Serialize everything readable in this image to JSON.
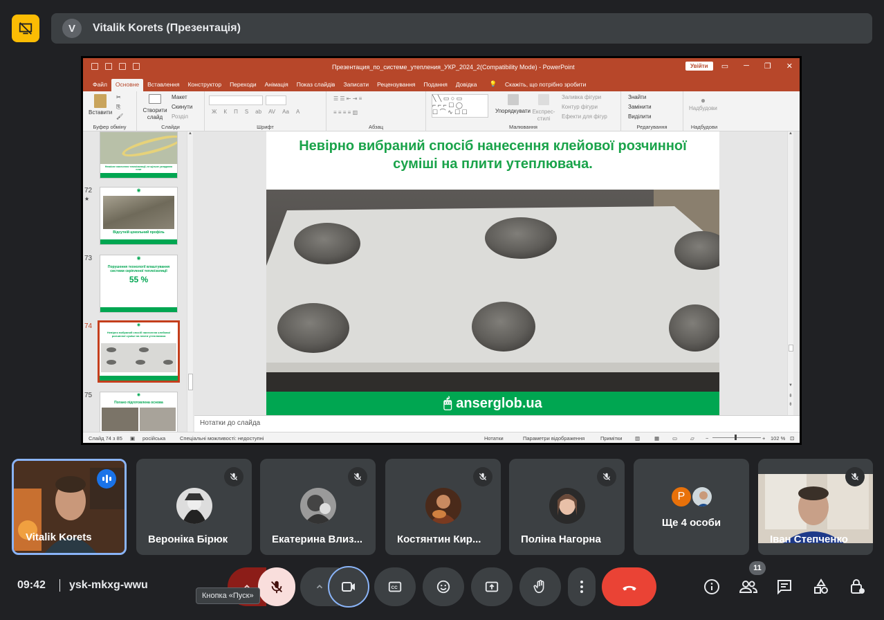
{
  "presentation_bar": {
    "avatar_letter": "V",
    "title": "Vitalik Korets (Презентація)"
  },
  "ppt": {
    "doc_title": "Презентация_по_системе_утепления_УКР_2024_2(Compatibility Mode)  -  PowerPoint",
    "sign_in": "Увійти",
    "tabs": [
      "Файл",
      "Основне",
      "Вставлення",
      "Конструктор",
      "Переходи",
      "Анімація",
      "Показ слайдів",
      "Записати",
      "Рецензування",
      "Подання",
      "Довідка"
    ],
    "active_tab": "Основне",
    "tell_me": "Скажіть, що потрібно зробити",
    "ribbon": {
      "paste": "Вставити",
      "clipboard": "Буфер обміну",
      "new_slide": "Створити слайд",
      "layout": "Макет",
      "reset": "Скинути",
      "section": "Розділ",
      "slides": "Слайди",
      "font": "Шрифт",
      "font_buttons": [
        "Ж",
        "К",
        "П",
        "S",
        "ab",
        "AV",
        "Aa",
        "A"
      ],
      "paragraph": "Абзац",
      "arrange": "Упорядкувати",
      "quick_styles": "Експрес-стилі",
      "shape_fill": "Заливка фігури",
      "shape_outline": "Контур фігури",
      "shape_effects": "Ефекти для фігур",
      "drawing": "Малювання",
      "find": "Знайти",
      "replace": "Замінити",
      "select": "Виділити",
      "editing": "Редагування",
      "addins_btn": "Надбудови",
      "addins": "Надбудови"
    },
    "thumbnails": [
      {
        "num": "",
        "caption": "Неякісне нанесення теплоізоляції, не щільне укладання плит",
        "footer": "anserglob.ua"
      },
      {
        "num": "72",
        "star": "★",
        "caption": "Відсутній цокольний профіль",
        "footer": "anserglob.ua"
      },
      {
        "num": "73",
        "caption": "Порушення технології влаштування системи скріпленої теплоізоляції",
        "value": "55 %",
        "footer": "anserglob.ua"
      },
      {
        "num": "74",
        "caption": "Невірно вибраний спосіб нанесення клейової розчинної суміші на плити утеплювача",
        "footer": "anserglob.ua"
      },
      {
        "num": "75",
        "caption": "Погано підготовлена основа",
        "footer": ""
      }
    ],
    "slide": {
      "title_line1": "Невірно вибраний спосіб нанесення клейової розчинної",
      "title_line2": "суміші на плити утеплювача.",
      "footer": "anserglob.ua"
    },
    "notes": "Нотатки до слайда",
    "status": {
      "slide": "Слайд 74 з 85",
      "lang": "російська",
      "accessibility": "Спеціальні можливості: недоступні",
      "notes": "Нотатки",
      "display": "Параметри відображення",
      "comments": "Примітки",
      "zoom": "102 %"
    }
  },
  "participants": [
    {
      "name": "Vitalik Korets",
      "speaking": true
    },
    {
      "name": "Вероніка Бірюк",
      "muted": true
    },
    {
      "name": "Екатерина Влиз...",
      "muted": true
    },
    {
      "name": "Костянтин Кир...",
      "muted": true
    },
    {
      "name": "Поліна Нагорна",
      "muted": true
    },
    {
      "name": "Ще 4 особи",
      "avatar_letter": "P"
    },
    {
      "name": "Іван Степченко",
      "muted": true
    }
  ],
  "bottom": {
    "time": "09:42",
    "meeting_code": "ysk-mkxg-wwu",
    "tooltip": "Кнопка «Пуск»",
    "people_count": "11"
  },
  "colors": {
    "ppt_red": "#b7472a",
    "brand_green": "#00a651",
    "end_call": "#ea4335",
    "muted_bg": "#f9dedc",
    "camera_ring": "#8ab4f8"
  }
}
